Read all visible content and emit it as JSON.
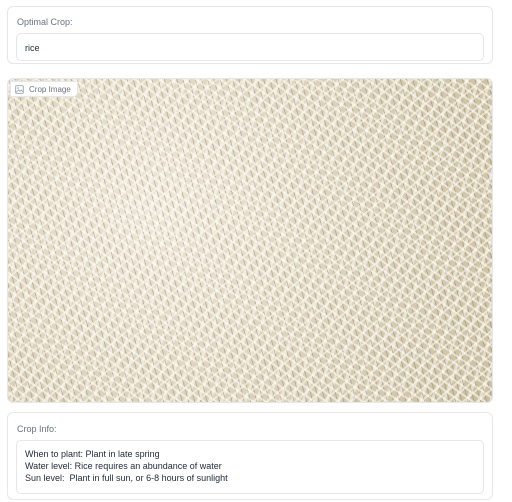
{
  "optimal_crop": {
    "label": "Optimal Crop:",
    "value": "rice"
  },
  "image_panel": {
    "label": "Crop Image",
    "icon": "image-icon"
  },
  "crop_info": {
    "label": "Crop Info:",
    "lines": [
      "When to plant: Plant in late spring",
      "Water level: Rice requires an abundance of water",
      "Sun level:  Plant in full sun, or 6-8 hours of sunlight"
    ]
  }
}
